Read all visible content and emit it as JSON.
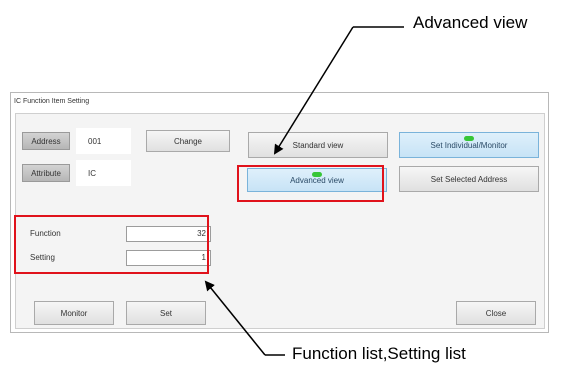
{
  "callouts": {
    "advanced": "Advanced view",
    "function_setting": "Function list,Setting list"
  },
  "window": {
    "title": "IC Function Item Setting"
  },
  "address": {
    "label": "Address",
    "value": "001",
    "change_label": "Change"
  },
  "attribute": {
    "label": "Attribute",
    "value": "IC"
  },
  "views": {
    "standard_label": "Standard view",
    "advanced_label": "Advanced view"
  },
  "targets": {
    "individual_label": "Set Individual/Monitor",
    "selected_label": "Set Selected Address"
  },
  "function": {
    "label": "Function",
    "value": "32"
  },
  "setting": {
    "label": "Setting",
    "value": "1"
  },
  "footer": {
    "monitor_label": "Monitor",
    "set_label": "Set",
    "close_label": "Close"
  },
  "colors": {
    "highlight": "#e0121b",
    "indicator": "#37c637",
    "active_button": "#c7e3f6"
  }
}
